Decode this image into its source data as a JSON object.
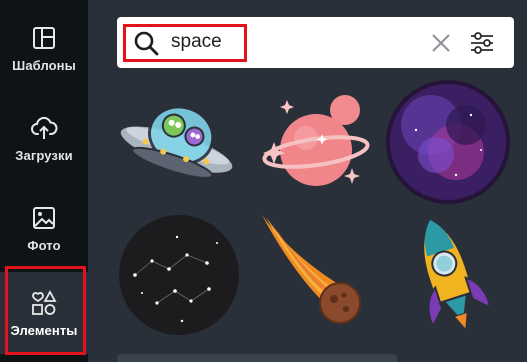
{
  "sidebar": {
    "items": [
      {
        "label": "Шаблоны",
        "icon": "templates-icon"
      },
      {
        "label": "Загрузки",
        "icon": "upload-cloud-icon"
      },
      {
        "label": "Фото",
        "icon": "photo-icon"
      },
      {
        "label": "Элементы",
        "icon": "elements-icon"
      }
    ],
    "active": "Элементы"
  },
  "search": {
    "value": "space",
    "icon": "search-icon",
    "clear_icon": "close-icon",
    "filter_icon": "filter-sliders-icon"
  },
  "results": [
    {
      "name": "ufo-aliens-sticker"
    },
    {
      "name": "pink-planet-sticker"
    },
    {
      "name": "galaxy-nebula-circle"
    },
    {
      "name": "constellation-circle"
    },
    {
      "name": "meteor-comet-sticker"
    },
    {
      "name": "rocket-sticker"
    }
  ],
  "colors": {
    "sidebar_bg": "#0e1318",
    "panel_bg": "#293039",
    "highlight": "#e3131b"
  }
}
